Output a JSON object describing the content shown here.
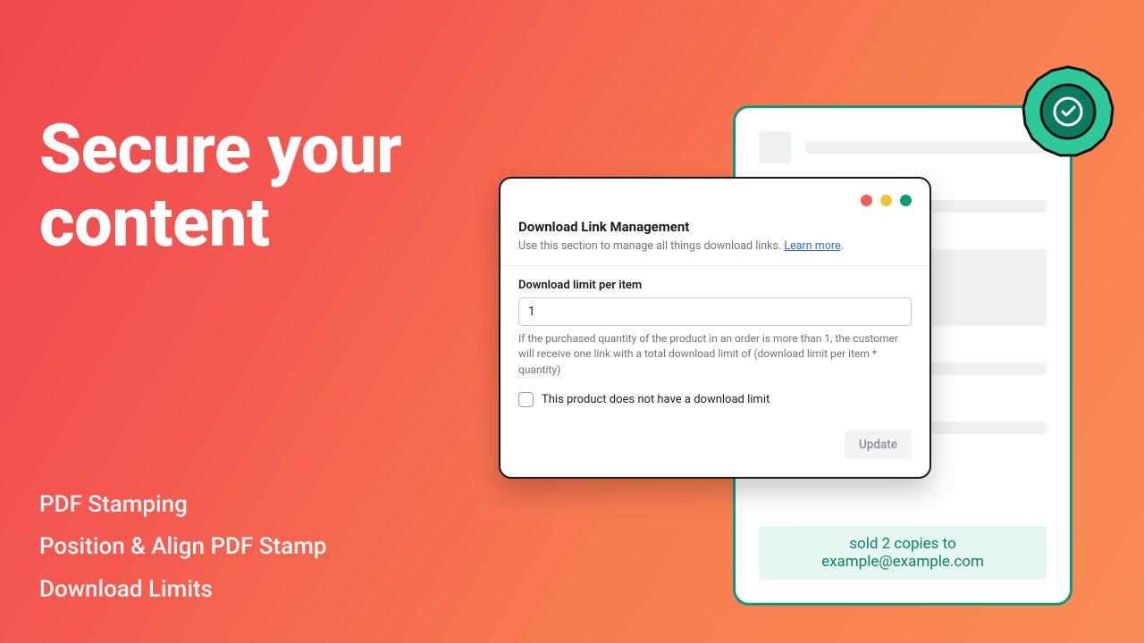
{
  "headline_l1": "Secure your",
  "headline_l2": "content",
  "features": {
    "f1": "PDF Stamping",
    "f2": "Position & Align PDF Stamp",
    "f3": "Download Limits"
  },
  "dialog": {
    "title": "Download Link Management",
    "subtitle_pre": "Use this section to manage all things download links. ",
    "learn_more": "Learn more",
    "field_label": "Download limit per item",
    "field_value": "1",
    "help_text": "If the purchased quantity of the product in an order is more than 1, the customer will receive one link with a total download limit of (download limit per item * quantity)",
    "checkbox_label": "This product does not have a download limit",
    "update_label": "Update"
  },
  "sold_pill": "sold 2 copies to example@example.com"
}
